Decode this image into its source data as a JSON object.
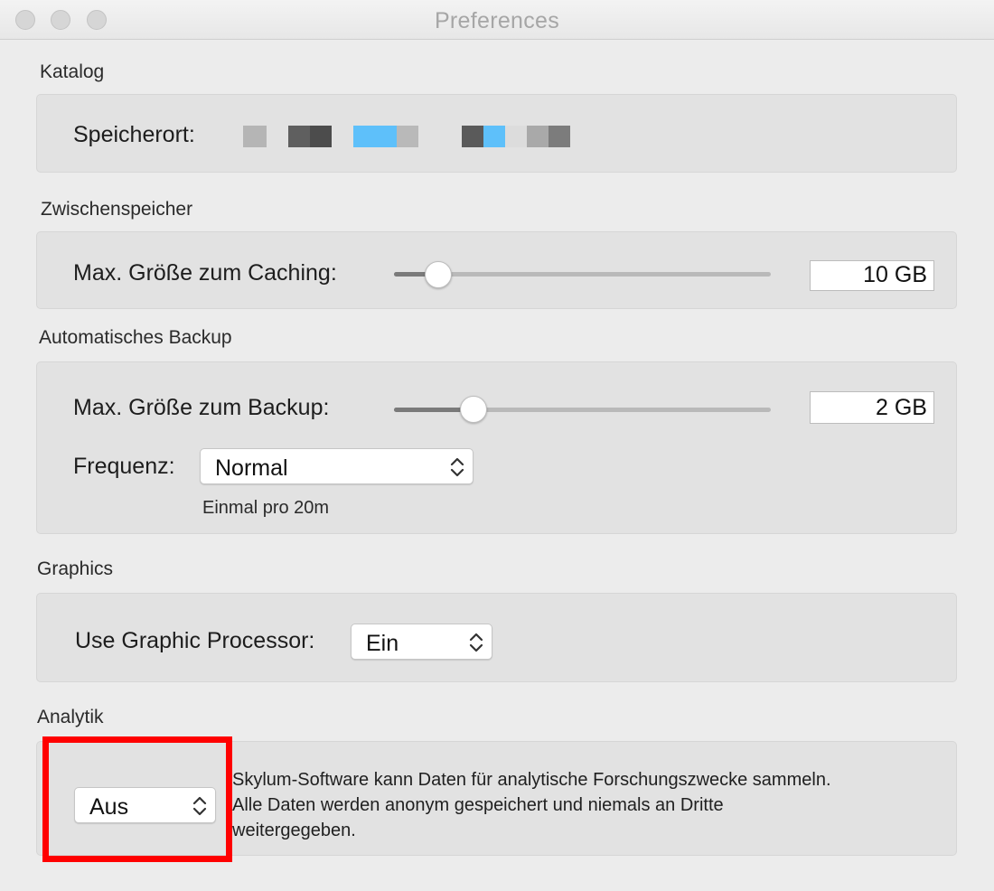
{
  "window": {
    "title": "Preferences"
  },
  "sections": {
    "catalog": {
      "heading": "Katalog",
      "location_label": "Speicherort:"
    },
    "cache": {
      "heading": "Zwischenspeicher",
      "max_size_label": "Max. Größe zum Caching:",
      "max_size_value": "10 GB",
      "slider_fraction": 0.12
    },
    "backup": {
      "heading": "Automatisches Backup",
      "max_size_label": "Max. Größe zum Backup:",
      "max_size_value": "2 GB",
      "slider_fraction": 0.21,
      "frequency_label": "Frequenz:",
      "frequency_value": "Normal",
      "frequency_hint": "Einmal pro 20m"
    },
    "graphics": {
      "heading": "Graphics",
      "gpu_label": "Use Graphic Processor:",
      "gpu_value": "Ein"
    },
    "analytics": {
      "heading": "Analytik",
      "value": "Aus",
      "description_line1": "Skylum-Software kann Daten für analytische Forschungszwecke sammeln.",
      "description_line2": "Alle Daten werden anonym gespeichert und niemals an Dritte",
      "description_line3": "weitergegeben."
    }
  },
  "colors": {
    "highlight": "#ff0000",
    "pixelated_blue": "#5ec0fa"
  }
}
